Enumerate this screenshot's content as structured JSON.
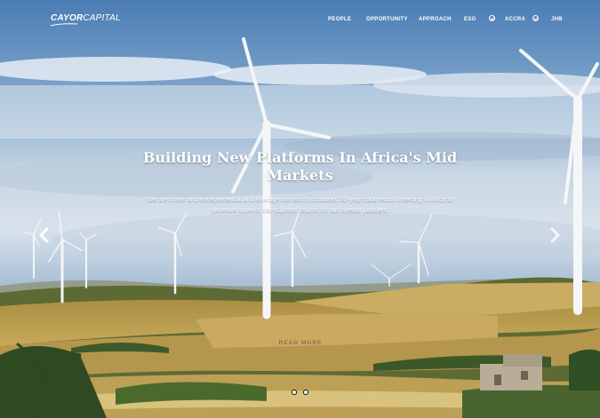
{
  "brand": {
    "name": "CAYOR CAPITAL",
    "logo_part1": "CAYOR",
    "logo_part2": "CAPITAL"
  },
  "nav": {
    "items": [
      {
        "label": "PEOPLE"
      },
      {
        "label": "OPPORTUNITY"
      },
      {
        "label": "APPROACH"
      },
      {
        "label": "ESG"
      }
    ],
    "cities": [
      {
        "label": "ACCRA",
        "icon": "compass-icon"
      },
      {
        "label": "JHB",
        "icon": "compass-icon"
      }
    ]
  },
  "hero": {
    "headline": "Building New Platforms In Africa's Mid Markets",
    "subtext": "We are driven and entrepreneurial and leverage the team's combined 30-year track record investing in Africa to generate superior risk-adjusted returns for our investor partners.",
    "read_more": "READ MORE",
    "slides_total": 2,
    "active_slide": 1
  },
  "colors": {
    "sky_top": "#4d7fb5",
    "sky_bottom": "#c9d8e6",
    "field": "#b99a4a",
    "accent_button": "#9b5a3c"
  }
}
